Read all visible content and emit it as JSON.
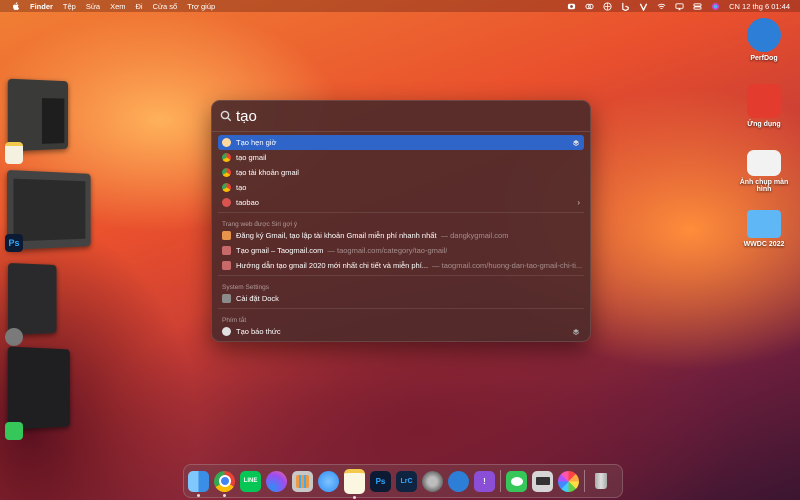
{
  "menubar": {
    "app": "Finder",
    "menus": [
      "Tệp",
      "Sửa",
      "Xem",
      "Đi",
      "Cửa sổ",
      "Trợ giúp"
    ],
    "right_icons": [
      "record-icon",
      "creative-cloud-icon",
      "vpn-icon",
      "bing-icon",
      "vector-icon",
      "wifi-icon",
      "screen-mirror-icon",
      "control-center-icon",
      "siri-icon"
    ],
    "clock": "CN 12 thg 6  01:44"
  },
  "desktop_icons": [
    {
      "label": "PerfDog",
      "icon": "perfdog-icon"
    },
    {
      "label": "Ứng dụng",
      "icon": "adobe-cc-icon"
    },
    {
      "label": "Ảnh chụp màn hình",
      "icon": "screenshot-icon"
    },
    {
      "label": "WWDC 2022",
      "icon": "folder-icon"
    }
  ],
  "spotlight": {
    "query": "tạo",
    "top_results": [
      {
        "title": "Tạo hẹn giờ",
        "subtitle": "",
        "icon": "shortcuts-icon",
        "color": "#7a8fd0",
        "selected": true
      },
      {
        "title": "tạo gmail",
        "subtitle": "",
        "icon": "chrome-icon",
        "color": "#34a853"
      },
      {
        "title": "tạo tài khoản gmail",
        "subtitle": "",
        "icon": "chrome-icon",
        "color": "#34a853"
      },
      {
        "title": "tạo",
        "subtitle": "",
        "icon": "chrome-icon",
        "color": "#34a853"
      },
      {
        "title": "taobao",
        "subtitle": "",
        "icon": "search-suggest-icon",
        "color": "#d9534f"
      }
    ],
    "siri_section": "Trang web được Siri gợi ý",
    "siri_results": [
      {
        "title": "Đăng ký Gmail, tạo lập tài khoản Gmail miễn phí nhanh nhất",
        "subtitle": "— dangkygmail.com",
        "color": "#e8944a"
      },
      {
        "title": "Tạo gmail – Taogmail.com",
        "subtitle": "— taogmail.com/category/tao-gmail/",
        "color": "#c96a6a"
      },
      {
        "title": "Hướng dẫn tạo gmail 2020 mới nhất chi tiết và miễn phí...",
        "subtitle": "— taogmail.com/huong-dan-tao-gmail-chi-ti...",
        "color": "#c96a6a"
      }
    ],
    "settings_section": "System Settings",
    "settings_results": [
      {
        "title": "Cài đặt Dock",
        "subtitle": "",
        "color": "#6b6b6b"
      }
    ],
    "shortcuts_section": "Phím tắt",
    "shortcuts_results": [
      {
        "title": "Tạo báo thức",
        "subtitle": "",
        "color": "#e0e0e0"
      }
    ]
  },
  "dock": {
    "apps": [
      {
        "name": "finder-icon",
        "color": "#3a8ee6",
        "text": ""
      },
      {
        "name": "chrome-icon",
        "color": "#e8e8e8",
        "text": ""
      },
      {
        "name": "line-icon",
        "color": "#06c755",
        "text": "LINE"
      },
      {
        "name": "messenger-icon",
        "color": "#a04cf0",
        "text": ""
      },
      {
        "name": "launchpad-icon",
        "color": "#c8c8c8",
        "text": ""
      },
      {
        "name": "safari-icon",
        "color": "#2e8ef5",
        "text": ""
      },
      {
        "name": "notes-icon",
        "color": "#f7e58a",
        "text": ""
      },
      {
        "name": "photoshop-icon",
        "color": "#0c1a33",
        "text": "Ps"
      },
      {
        "name": "lightroom-classic-icon",
        "color": "#0f2440",
        "text": "LrC"
      },
      {
        "name": "system-settings-icon",
        "color": "#8b8b8b",
        "text": ""
      },
      {
        "name": "perfdog-icon",
        "color": "#2c7ed6",
        "text": ""
      },
      {
        "name": "feedback-icon",
        "color": "#8a4fd6",
        "text": "!"
      },
      {
        "name": "messages-icon",
        "color": "#35c759",
        "text": ""
      },
      {
        "name": "screenshot-app-icon",
        "color": "#d6d6d6",
        "text": ""
      },
      {
        "name": "photos-icon",
        "color": "#f2f2f2",
        "text": ""
      },
      {
        "name": "trash-icon",
        "color": "#bdbdbd",
        "text": ""
      }
    ]
  }
}
